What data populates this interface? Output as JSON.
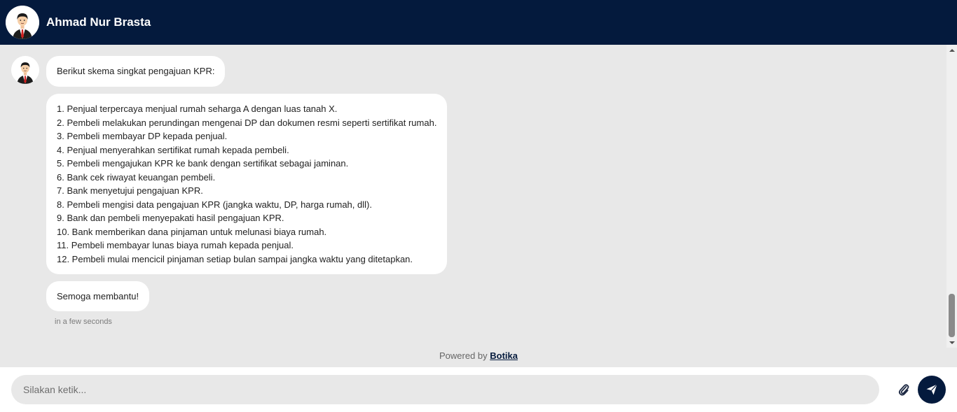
{
  "header": {
    "name": "Ahmad Nur Brasta"
  },
  "messages": {
    "intro": "Berikut skema singkat pengajuan KPR:",
    "steps": [
      "1. Penjual terpercaya menjual rumah seharga A dengan luas tanah X.",
      "2. Pembeli melakukan perundingan mengenai DP dan dokumen resmi seperti sertifikat rumah.",
      "3. Pembeli membayar DP kepada penjual.",
      "4. Penjual menyerahkan sertifikat rumah kepada pembeli.",
      "5. Pembeli mengajukan KPR ke bank dengan sertifikat sebagai jaminan.",
      "6. Bank cek riwayat keuangan pembeli.",
      "7. Bank menyetujui pengajuan KPR.",
      "8. Pembeli mengisi data pengajuan KPR (jangka waktu, DP, harga rumah, dll).",
      "9. Bank dan pembeli menyepakati hasil pengajuan KPR.",
      "10. Bank memberikan dana pinjaman untuk melunasi biaya rumah.",
      "11. Pembeli membayar lunas biaya rumah kepada penjual.",
      "12. Pembeli mulai mencicil pinjaman setiap bulan sampai jangka waktu yang ditetapkan."
    ],
    "closing": "Semoga membantu!",
    "timestamp": "in a few seconds"
  },
  "footer": {
    "powered_prefix": "Powered by",
    "brand": "Botika"
  },
  "composer": {
    "placeholder": "Silakan ketik...",
    "attach_icon": "paperclip-icon",
    "send_icon": "send-icon"
  },
  "colors": {
    "primary": "#041a3d",
    "chat_background": "#e8e8e8",
    "bubble": "#ffffff"
  }
}
